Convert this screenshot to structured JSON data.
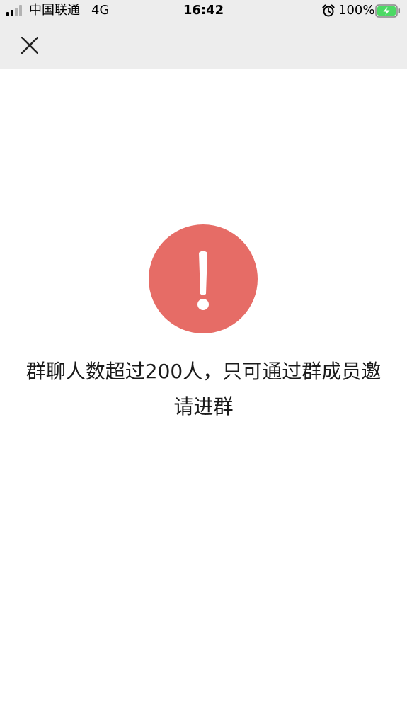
{
  "status_bar": {
    "carrier": "中国联通",
    "network": "4G",
    "time": "16:42",
    "battery_percent": "100%",
    "icons": [
      "signal-icon",
      "alarm-icon",
      "battery-charging-icon"
    ]
  },
  "nav": {
    "close_icon": "close-icon"
  },
  "alert": {
    "icon": "exclamation-icon",
    "icon_color": "#e66c66",
    "message": "群聊人数超过200人，只可通过群成员邀请进群"
  },
  "colors": {
    "top_bar_bg": "#ededed",
    "page_bg": "#ffffff",
    "battery_green": "#4cd964"
  }
}
